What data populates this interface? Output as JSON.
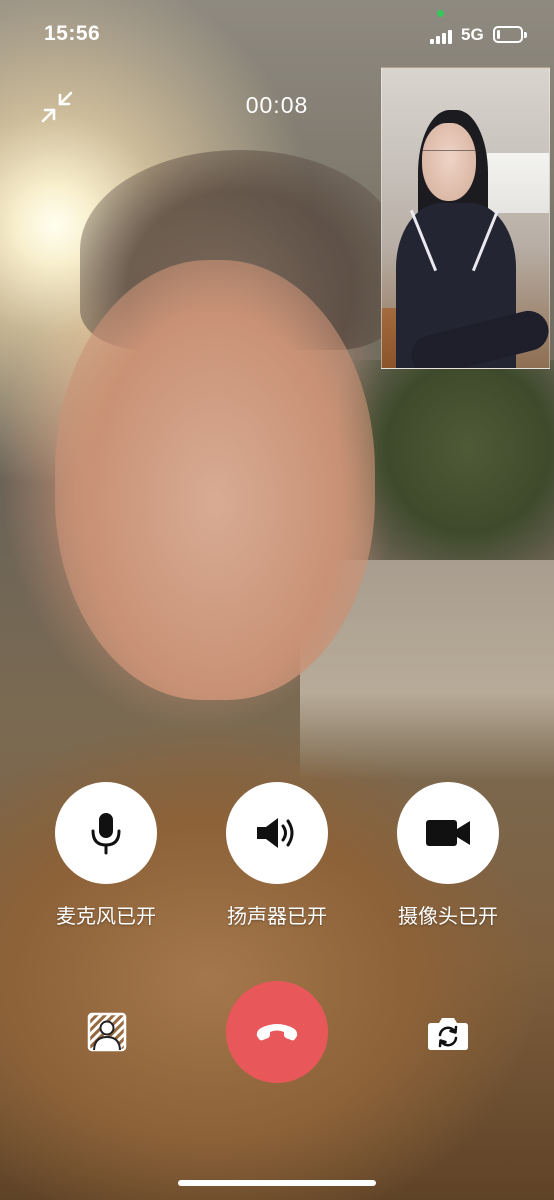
{
  "status_bar": {
    "time": "15:56",
    "network": "5G",
    "battery_level": 0.15,
    "active_dot_color": "#35c759"
  },
  "call": {
    "timer": "00:08",
    "minimize_icon": "collapse-arrows-icon"
  },
  "controls": [
    {
      "icon": "microphone-icon",
      "label": "麦克风已开"
    },
    {
      "icon": "speaker-icon",
      "label": "扬声器已开"
    },
    {
      "icon": "video-camera-icon",
      "label": "摄像头已开"
    }
  ],
  "bottom_actions": {
    "left_icon": "background-blur-icon",
    "center_icon": "hang-up-icon",
    "right_icon": "switch-camera-icon",
    "hangup_color": "#e8585a"
  }
}
